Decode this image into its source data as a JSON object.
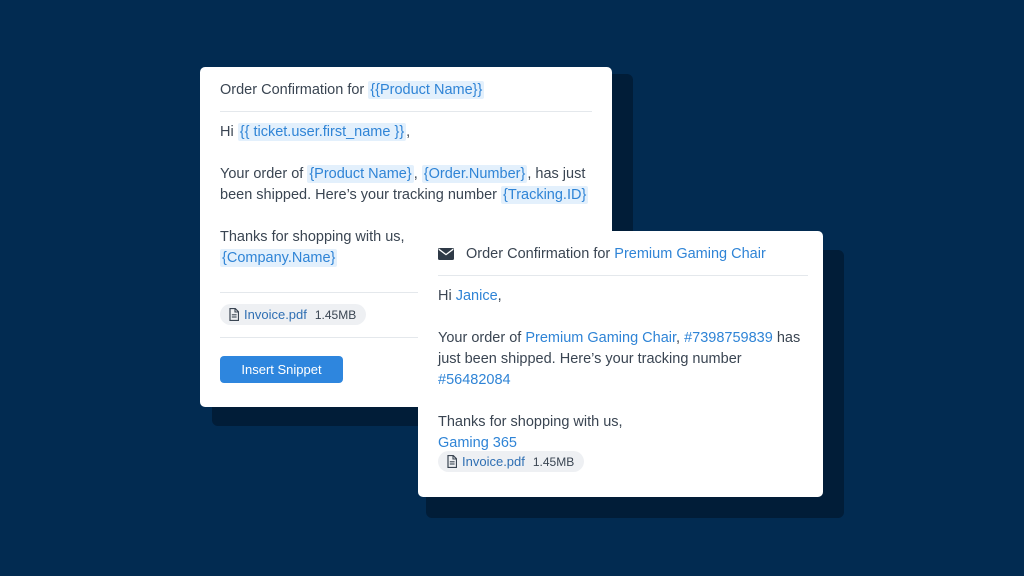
{
  "colors": {
    "background": "#022b51",
    "accent": "#2e86de",
    "variable_text": "#2f84d6",
    "variable_highlight": "#e3f0fc"
  },
  "template_card": {
    "title_prefix": "Order Confirmation for ",
    "title_var": "{{Product Name}}",
    "greeting_prefix": "Hi ",
    "greeting_var": "{{ ticket.user.first_name }}",
    "greeting_suffix": ",",
    "order_prefix": "Your order of ",
    "order_var_product": "{Product Name}",
    "order_sep": ", ",
    "order_var_number": "{Order.Number}",
    "order_mid": ", has just been shipped. Here’s your tracking number ",
    "order_var_tracking": "{Tracking.ID}",
    "thanks": "Thanks for shopping with us,",
    "thanks_var": "{Company.Name}",
    "attachment": {
      "icon": "document-icon",
      "name": "Invoice.pdf",
      "size": "1.45MB"
    },
    "insert_button": "Insert Snippet"
  },
  "preview_card": {
    "title_icon": "envelope-icon",
    "title_prefix": "Order Confirmation for ",
    "title_value": "Premium Gaming Chair",
    "greeting_prefix": "Hi ",
    "greeting_value": "Janice",
    "greeting_suffix": ",",
    "order_prefix": "Your order of ",
    "order_product": "Premium Gaming Chair",
    "order_sep": ", ",
    "order_number": "#7398759839",
    "order_mid": " has just been shipped. Here’s your tracking number ",
    "order_tracking": "#56482084",
    "thanks": "Thanks for shopping with us,",
    "company": "Gaming 365",
    "attachment": {
      "icon": "document-icon",
      "name": "Invoice.pdf",
      "size": "1.45MB"
    }
  }
}
